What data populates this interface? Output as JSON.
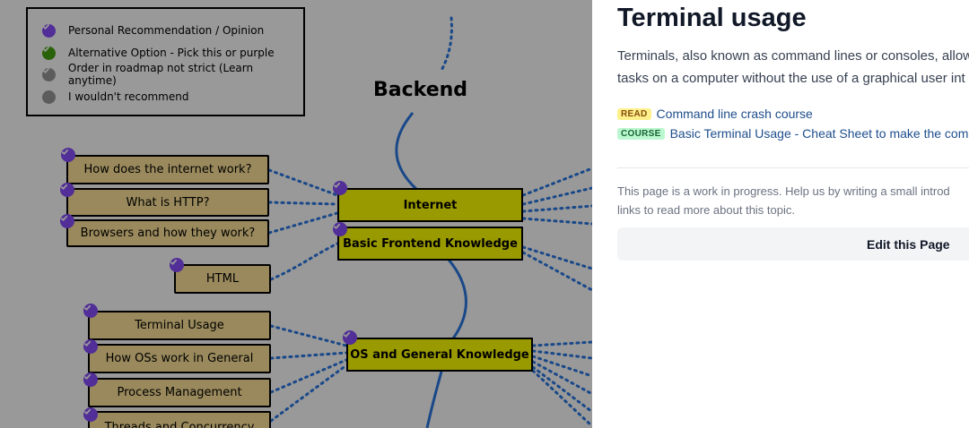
{
  "legend": {
    "items": [
      {
        "label": "Personal Recommendation / Opinion",
        "color": "#874efe"
      },
      {
        "label": "Alternative Option - Pick this or purple",
        "color": "#46a40f"
      },
      {
        "label": "Order in roadmap not strict (Learn anytime)",
        "color": "#999999"
      },
      {
        "label": "I wouldn't recommend",
        "color": "#999999"
      }
    ]
  },
  "roadmap": {
    "title": "Backend",
    "topics": {
      "internet": "Internet",
      "frontend": "Basic Frontend Knowledge",
      "os": "OS and General Knowledge"
    },
    "subtopics": {
      "how_internet": "How does the internet work?",
      "http": "What is HTTP?",
      "browsers": "Browsers and how they work?",
      "html": "HTML",
      "terminal": "Terminal Usage",
      "os_work": "How OSs work in General",
      "process": "Process Management",
      "threads": "Threads and Concurrency"
    }
  },
  "drawer": {
    "title": "Terminal usage",
    "desc_line1": "Terminals, also known as command lines or consoles, allow",
    "desc_line2": "tasks on a computer without the use of a graphical user int",
    "resources": [
      {
        "type": "READ",
        "label": "Command line crash course"
      },
      {
        "type": "COURSE",
        "label": "Basic Terminal Usage - Cheat Sheet to make the comm"
      }
    ],
    "wip_line1": "This page is a work in progress. Help us by writing a small introd",
    "wip_line2": "links to read more about this topic.",
    "edit_label": "Edit this Page"
  },
  "colors": {
    "checkmark": "#874efe",
    "topic_fill": "#ffff00",
    "subtopic_fill": "#ffe599",
    "connector": "#2b78e4",
    "link": "#1e4e8c"
  }
}
